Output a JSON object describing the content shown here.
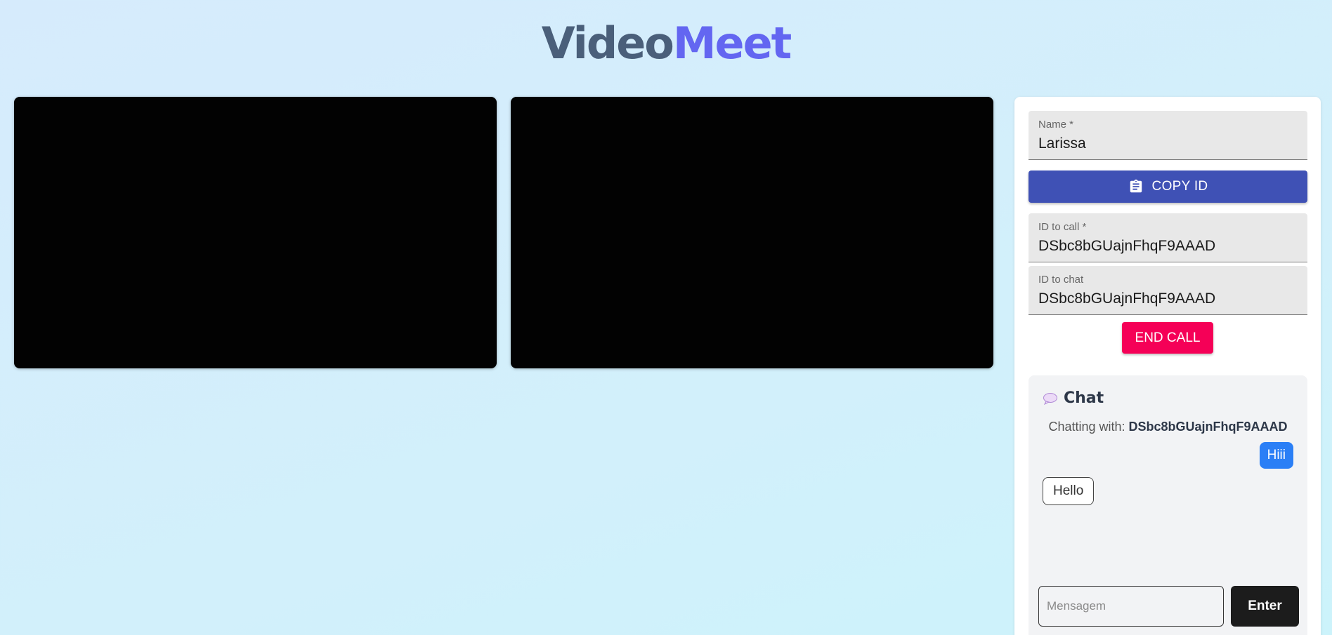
{
  "app": {
    "title_part_1": "Video",
    "title_part_2": "Meet"
  },
  "form": {
    "name_label": "Name *",
    "name_value": "Larissa",
    "copy_id_label": "COPY ID",
    "id_to_call_label": "ID to call *",
    "id_to_call_value": "DSbc8bGUajnFhqF9AAAD",
    "id_to_chat_label": "ID to chat",
    "id_to_chat_value": "DSbc8bGUajnFhqF9AAAD",
    "end_call_label": "END CALL"
  },
  "chat": {
    "title": "Chat",
    "chatting_with_prefix": "Chatting with:",
    "chatting_with_id": "DSbc8bGUajnFhqF9AAAD",
    "messages": [
      {
        "from": "me",
        "text": "Hiii"
      },
      {
        "from": "other",
        "text": "Hello"
      }
    ],
    "input_placeholder": "Mensagem",
    "send_label": "Enter"
  },
  "colors": {
    "title_dark": "#4a5f7a",
    "title_accent": "#6366f1",
    "copy_button": "#3f51b5",
    "end_call_button": "#f50057",
    "sent_bubble": "#2b7ff6",
    "send_button": "#1c1c1c"
  },
  "icons": {
    "copy_button": "clipboard-icon",
    "chat_heading": "speech-bubble-icon"
  }
}
